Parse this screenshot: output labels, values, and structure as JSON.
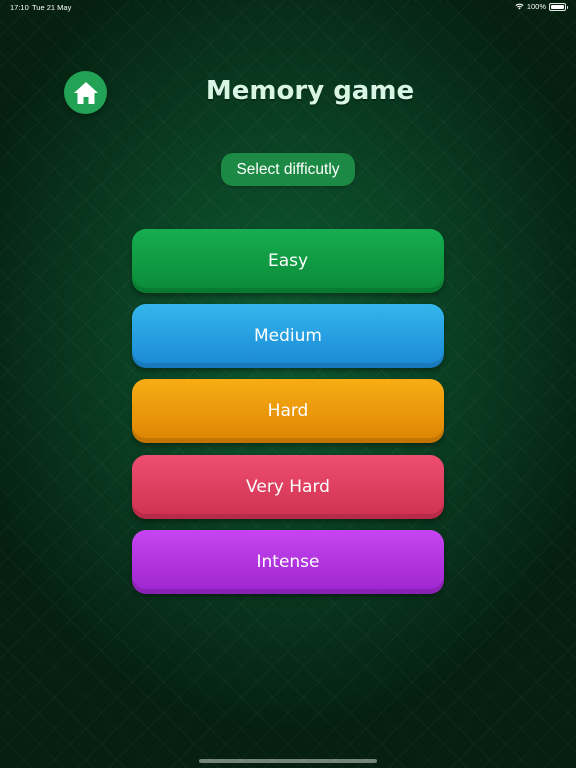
{
  "status_bar": {
    "time": "17:10",
    "date": "Tue 21 May",
    "battery": "100%"
  },
  "header": {
    "home_icon": "home-icon",
    "title": "Memory game",
    "subtitle": "Select difficutly"
  },
  "levels": [
    {
      "label": "Easy",
      "color": "#0f9c45"
    },
    {
      "label": "Medium",
      "color": "#2a9fe3"
    },
    {
      "label": "Hard",
      "color": "#ec9809"
    },
    {
      "label": "Very Hard",
      "color": "#df3f60"
    },
    {
      "label": "Intense",
      "color": "#b235df"
    }
  ],
  "colors": {
    "background": "#0a4224",
    "home_button": "#21a255",
    "badge": "#1c8a45",
    "title_text": "#d9f6e4"
  }
}
